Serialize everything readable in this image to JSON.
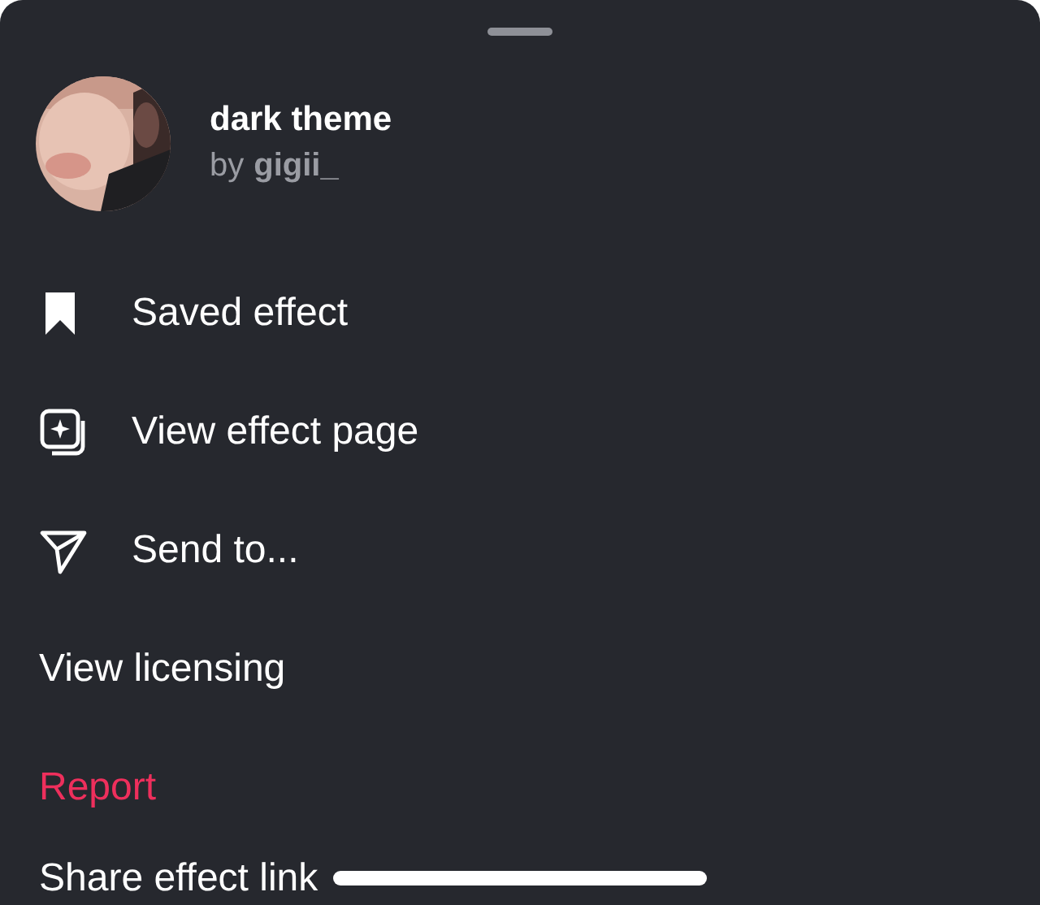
{
  "header": {
    "title": "dark theme",
    "by": "by",
    "author": "gigii_"
  },
  "items": [
    {
      "label": "Saved effect",
      "kind": "bookmark"
    },
    {
      "label": "View effect page",
      "kind": "effect"
    },
    {
      "label": "Send to...",
      "kind": "send"
    },
    {
      "label": "View licensing",
      "kind": "normal"
    },
    {
      "label": "Report",
      "kind": "danger"
    },
    {
      "label": "Share effect link",
      "kind": "normal"
    }
  ]
}
